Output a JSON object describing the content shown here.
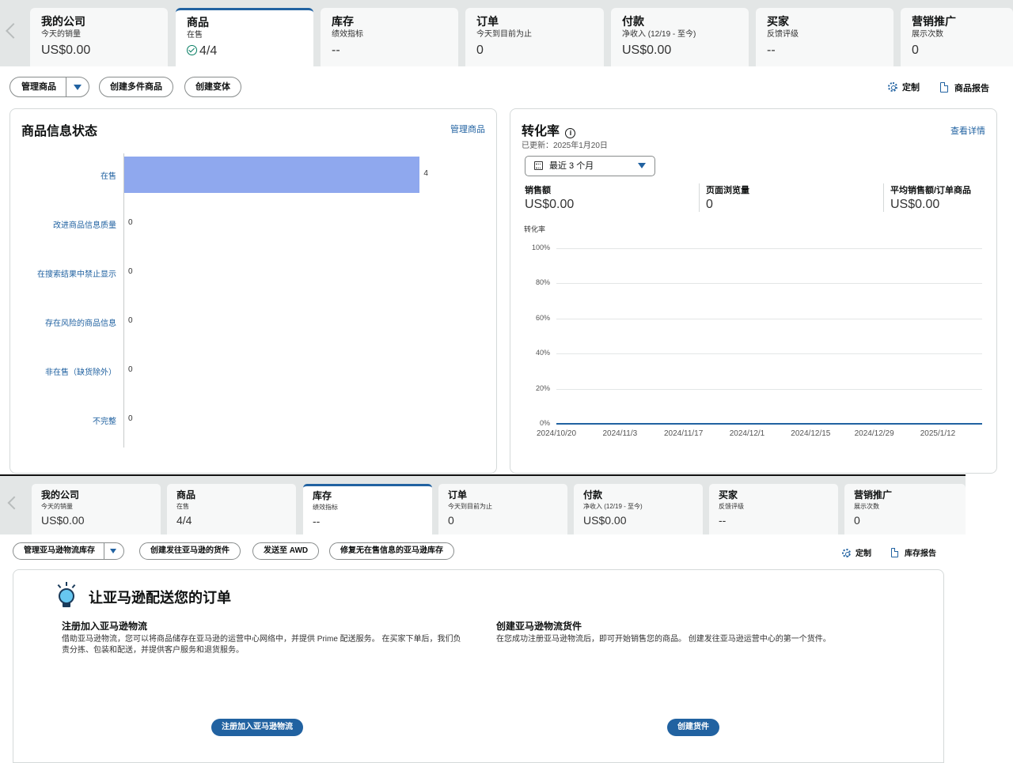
{
  "top": {
    "tabs": [
      {
        "title": "我的公司",
        "sub": "今天的销量",
        "value": "US$0.00",
        "check": false,
        "selected": false
      },
      {
        "title": "商品",
        "sub": "在售",
        "value": "4/4",
        "check": true,
        "selected": true
      },
      {
        "title": "库存",
        "sub": "绩效指标",
        "value": "--",
        "check": false,
        "selected": false
      },
      {
        "title": "订单",
        "sub": "今天到目前为止",
        "value": "0",
        "check": false,
        "selected": false
      },
      {
        "title": "付款",
        "sub": "净收入 (12/19 - 至今)",
        "value": "US$0.00",
        "check": false,
        "selected": false
      },
      {
        "title": "买家",
        "sub": "反馈评级",
        "value": "--",
        "check": false,
        "selected": false
      },
      {
        "title": "营销推广",
        "sub": "展示次数",
        "value": "0",
        "check": false,
        "selected": false
      }
    ],
    "actions": {
      "manage": "管理商品",
      "create_multi": "创建多件商品",
      "create_variant": "创建变体",
      "customize": "定制",
      "report": "商品报告"
    },
    "status_card": {
      "title": "商品信息状态",
      "link": "管理商品"
    },
    "conversion_card": {
      "title": "转化率",
      "updated": "已更新：2025年1月20日",
      "link": "查看详情",
      "date_range": "最近 3 个月",
      "metrics": [
        {
          "label": "销售额",
          "value": "US$0.00"
        },
        {
          "label": "页面浏览量",
          "value": "0"
        },
        {
          "label": "平均销售额/订单商品",
          "value": "US$0.00"
        }
      ]
    }
  },
  "chart_data": [
    {
      "type": "bar",
      "orientation": "horizontal",
      "title": "商品信息状态",
      "categories": [
        "在售",
        "改进商品信息质量",
        "在搜索结果中禁止显示",
        "存在风险的商品信息",
        "非在售（缺货除外）",
        "不完整"
      ],
      "values": [
        4,
        0,
        0,
        0,
        0,
        0
      ],
      "color": "#8fa8ee",
      "xlim": [
        0,
        4.5
      ]
    },
    {
      "type": "line",
      "title": "转化率",
      "ylabel": "转化率",
      "y_ticks": [
        "100%",
        "80%",
        "60%",
        "40%",
        "20%",
        "0%"
      ],
      "x_ticks": [
        "2024/10/20",
        "2024/11/3",
        "2024/11/17",
        "2024/12/1",
        "2024/12/15",
        "2024/12/29",
        "2025/1/12"
      ],
      "ylim": [
        0,
        100
      ],
      "series": [
        {
          "values": [
            0,
            0,
            0,
            0,
            0,
            0,
            0
          ],
          "color": "#2162a1"
        }
      ],
      "grid": true
    }
  ],
  "bottom": {
    "tabs": [
      {
        "title": "我的公司",
        "sub": "今天的销量",
        "value": "US$0.00",
        "check": false,
        "selected": false
      },
      {
        "title": "商品",
        "sub": "在售",
        "value": "4/4",
        "check": true,
        "selected": false
      },
      {
        "title": "库存",
        "sub": "绩效指标",
        "value": "--",
        "check": false,
        "selected": true
      },
      {
        "title": "订单",
        "sub": "今天到目前为止",
        "value": "0",
        "check": false,
        "selected": false
      },
      {
        "title": "付款",
        "sub": "净收入 (12/19 - 至今)",
        "value": "US$0.00",
        "check": false,
        "selected": false
      },
      {
        "title": "买家",
        "sub": "反馈评级",
        "value": "--",
        "check": false,
        "selected": false
      },
      {
        "title": "营销推广",
        "sub": "展示次数",
        "value": "0",
        "check": false,
        "selected": false
      }
    ],
    "actions": {
      "manage_fba": "管理亚马逊物流库存",
      "create_shipment": "创建发往亚马逊的货件",
      "send_awd": "发送至 AWD",
      "fix_stranded": "修复无在售信息的亚马逊库存",
      "customize": "定制",
      "report": "库存报告"
    },
    "promo": {
      "title": "让亚马逊配送您的订单",
      "left_heading": "注册加入亚马逊物流",
      "left_text": "借助亚马逊物流，您可以将商品储存在亚马逊的运营中心网络中，并提供 Prime 配送服务。 在买家下单后，我们负责分拣、包装和配送，并提供客户服务和退货服务。",
      "left_button": "注册加入亚马逊物流",
      "right_heading": "创建亚马逊物流货件",
      "right_text": "在您成功注册亚马逊物流后，即可开始销售您的商品。 创建发往亚马逊运营中心的第一个货件。",
      "right_button": "创建货件"
    }
  }
}
